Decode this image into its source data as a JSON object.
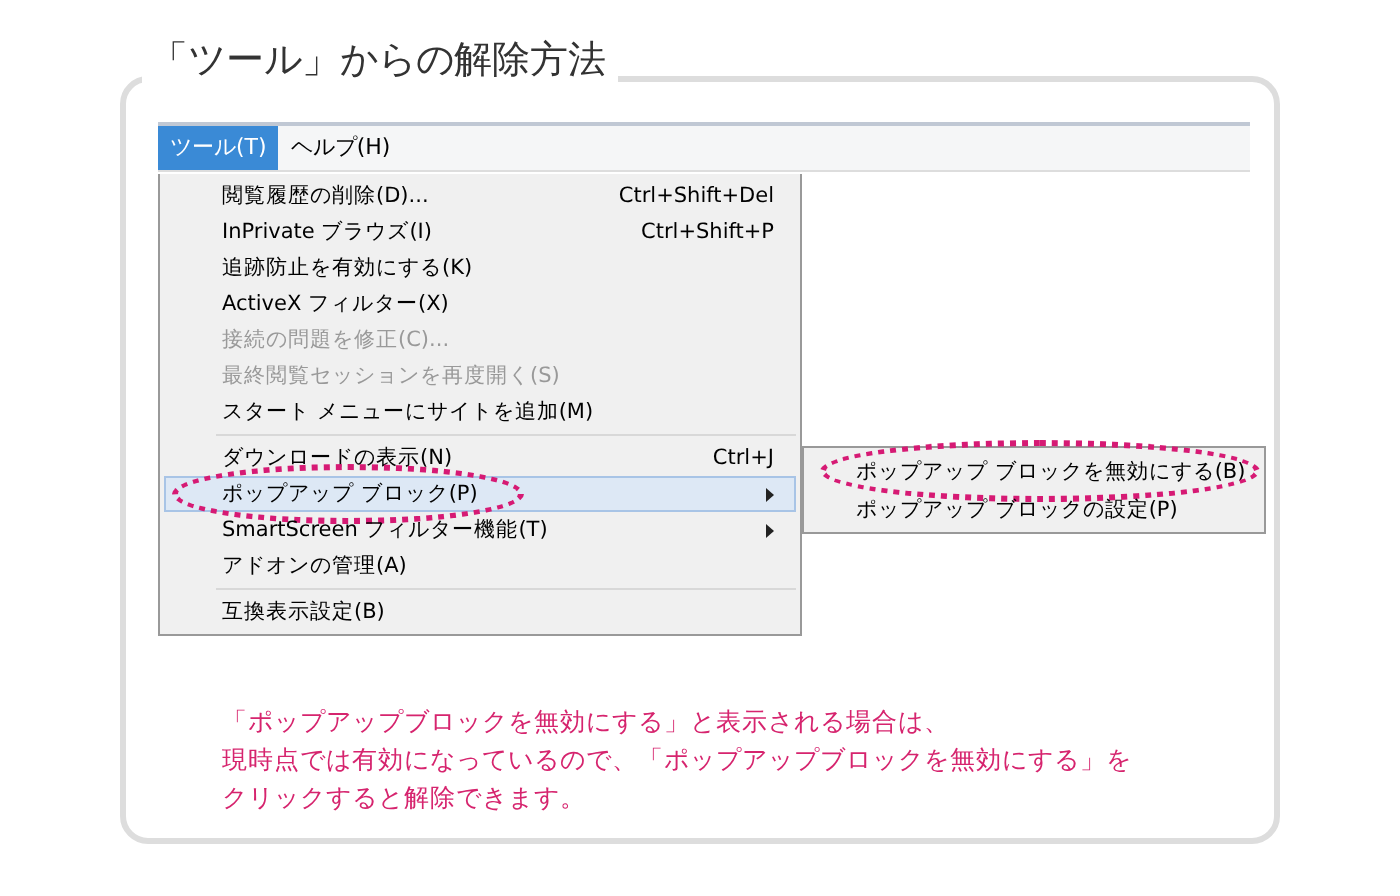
{
  "title": "「ツール」からの解除方法",
  "menubar": [
    {
      "label": "ツール(T)",
      "selected": true
    },
    {
      "label": "ヘルプ(H)",
      "selected": false
    }
  ],
  "menu": [
    {
      "kind": "item",
      "label": "閲覧履歴の削除(D)...",
      "shortcut": "Ctrl+Shift+Del",
      "disabled": false,
      "highlighted": false,
      "submenu": false,
      "circled": false
    },
    {
      "kind": "item",
      "label": "InPrivate ブラウズ(I)",
      "shortcut": "Ctrl+Shift+P",
      "disabled": false,
      "highlighted": false,
      "submenu": false,
      "circled": false
    },
    {
      "kind": "item",
      "label": "追跡防止を有効にする(K)",
      "disabled": false,
      "highlighted": false,
      "submenu": false,
      "circled": false
    },
    {
      "kind": "item",
      "label": "ActiveX フィルター(X)",
      "disabled": false,
      "highlighted": false,
      "submenu": false,
      "circled": false
    },
    {
      "kind": "item",
      "label": "接続の問題を修正(C)...",
      "disabled": true,
      "highlighted": false,
      "submenu": false,
      "circled": false
    },
    {
      "kind": "item",
      "label": "最終閲覧セッションを再度開く(S)",
      "disabled": true,
      "highlighted": false,
      "submenu": false,
      "circled": false
    },
    {
      "kind": "item",
      "label": "スタート メニューにサイトを追加(M)",
      "disabled": false,
      "highlighted": false,
      "submenu": false,
      "circled": false
    },
    {
      "kind": "separator"
    },
    {
      "kind": "item",
      "label": "ダウンロードの表示(N)",
      "shortcut": "Ctrl+J",
      "disabled": false,
      "highlighted": false,
      "submenu": false,
      "circled": false
    },
    {
      "kind": "item",
      "label": "ポップアップ ブロック(P)",
      "disabled": false,
      "highlighted": true,
      "submenu": true,
      "circled": true
    },
    {
      "kind": "item",
      "label": "SmartScreen フィルター機能(T)",
      "disabled": false,
      "highlighted": false,
      "submenu": true,
      "circled": false
    },
    {
      "kind": "item",
      "label": "アドオンの管理(A)",
      "disabled": false,
      "highlighted": false,
      "submenu": false,
      "circled": false
    },
    {
      "kind": "separator"
    },
    {
      "kind": "item",
      "label": "互換表示設定(B)",
      "disabled": false,
      "highlighted": false,
      "submenu": false,
      "circled": false
    }
  ],
  "submenu": [
    {
      "label": "ポップアップ ブロックを無効にする(B)",
      "circled": true
    },
    {
      "label": "ポップアップ ブロックの設定(P)",
      "circled": false
    }
  ],
  "note": [
    "「ポップアップブロックを無効にする」と表示される場合は、",
    "現時点では有効になっているので、「ポップアップブロックを無効にする」を",
    "クリックすると解除できます。"
  ]
}
